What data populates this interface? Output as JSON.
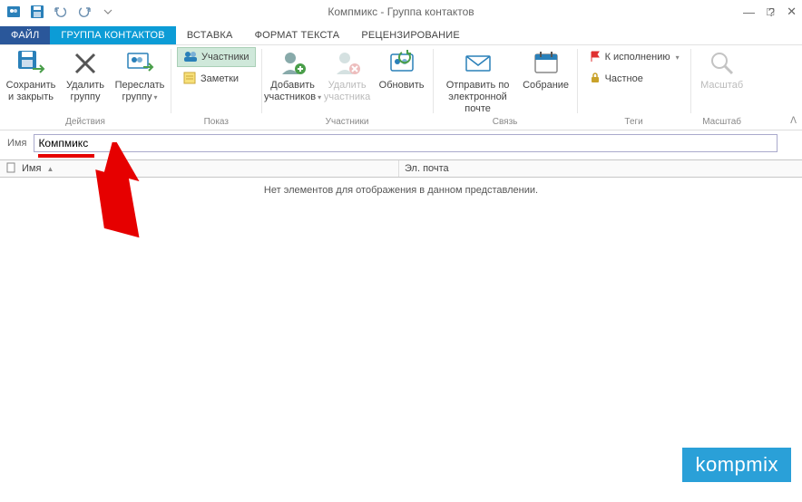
{
  "window": {
    "title": "Компмикс - Группа контактов"
  },
  "tabs": {
    "file": "ФАЙЛ",
    "group": "ГРУППА КОНТАКТОВ",
    "insert": "ВСТАВКА",
    "format": "ФОРМАТ ТЕКСТА",
    "review": "РЕЦЕНЗИРОВАНИЕ"
  },
  "ribbon": {
    "actions": {
      "save_close": "Сохранить\nи закрыть",
      "delete_group": "Удалить\nгруппу",
      "forward_group": "Переслать\nгруппу",
      "label": "Действия"
    },
    "show": {
      "members": "Участники",
      "notes": "Заметки",
      "label": "Показ"
    },
    "members_group": {
      "add": "Добавить\nучастников",
      "remove": "Удалить\nучастника",
      "update": "Обновить",
      "label": "Участники"
    },
    "connect": {
      "send_email": "Отправить по\nэлектронной почте",
      "meeting": "Собрание",
      "label": "Связь"
    },
    "tags": {
      "follow_up": "К исполнению",
      "private": "Частное",
      "label": "Теги"
    },
    "zoom": {
      "zoom": "Масштаб",
      "label": "Масштаб"
    }
  },
  "form": {
    "name_label": "Имя",
    "name_value": "Компмикс"
  },
  "columns": {
    "name": "Имя",
    "email": "Эл. почта"
  },
  "list": {
    "empty": "Нет элементов для отображения в данном представлении."
  },
  "watermark": "kompmix"
}
